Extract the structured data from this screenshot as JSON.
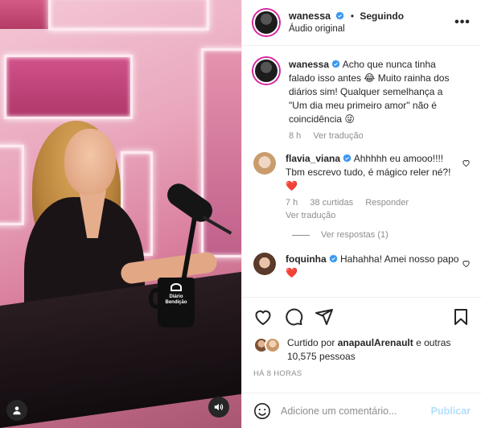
{
  "post": {
    "author": "wanessa",
    "follow_status": "Seguindo",
    "audio": "Áudio original",
    "mug_text": "Diário\nBendição"
  },
  "caption": {
    "username": "wanessa",
    "text": "Acho que nunca tinha falado isso antes 😂 Muito rainha dos diários sim! Qualquer semelhança a \"Um dia meu primeiro amor\" não é coincidência 😜",
    "time": "8 h",
    "translate": "Ver tradução"
  },
  "comments": [
    {
      "username": "flavia_viana",
      "text": "Ahhhhh eu amooo!!!! Tbm escrevo tudo, é mágico reler né?! ❤️",
      "time": "7 h",
      "likes": "38 curtidas",
      "reply": "Responder",
      "translate": "Ver tradução",
      "view_replies": "Ver respostas (1)"
    },
    {
      "username": "foquinha",
      "text": "Hahahha! Amei nosso papo ❤️"
    }
  ],
  "likes": {
    "prefix": "Curtido por ",
    "user": "anapaulArenault",
    "suffix": " e outras 10,575 pessoas"
  },
  "timestamp": "HÁ 8 HORAS",
  "composer": {
    "placeholder": "Adicione um comentário...",
    "publish": "Publicar"
  },
  "colors": {
    "verified": "#3897f0",
    "link_blue": "#b2dffc",
    "heart_red": "#ed4956"
  },
  "icons": [
    "verified-icon",
    "more-icon",
    "heart-icon",
    "comment-icon",
    "share-icon",
    "bookmark-icon",
    "emoji-icon",
    "profile-icon",
    "sound-icon"
  ]
}
